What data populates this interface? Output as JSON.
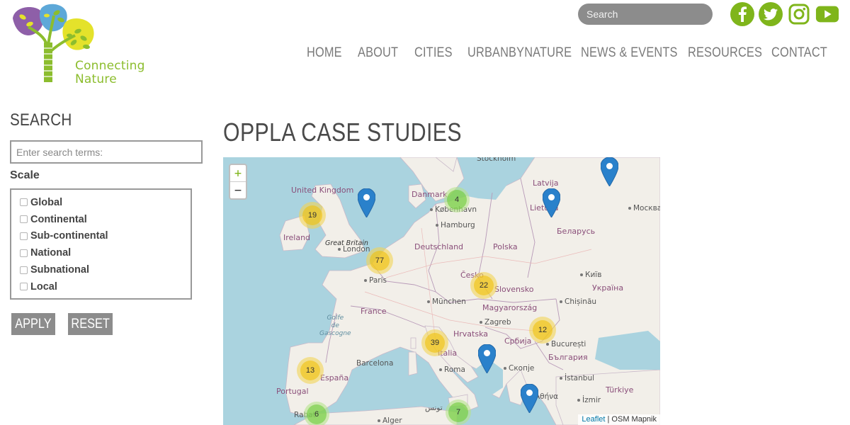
{
  "brand": {
    "logo_text_line1": "Connecting",
    "logo_text_line2": "Nature",
    "accent": "#7fb51b",
    "tree_colors": [
      "#8e5fa8",
      "#5da8d8",
      "#e4e22b",
      "#8cbd2e"
    ]
  },
  "header": {
    "search_placeholder": "Search",
    "social": [
      {
        "icon": "facebook-icon",
        "glyph": "f"
      },
      {
        "icon": "twitter-icon"
      },
      {
        "icon": "instagram-icon"
      },
      {
        "icon": "youtube-icon"
      }
    ]
  },
  "nav": {
    "items": [
      "HOME",
      "ABOUT",
      "CITIES",
      "URBANBYNATURE",
      "NEWS & EVENTS",
      "RESOURCES",
      "CONTACT"
    ]
  },
  "sidebar": {
    "title": "SEARCH",
    "search_placeholder": "Enter search terms:",
    "scale_label": "Scale",
    "scale_options": [
      "Global",
      "Continental",
      "Sub-continental",
      "National",
      "Subnational",
      "Local"
    ],
    "apply_label": "APPLY",
    "reset_label": "RESET"
  },
  "main": {
    "title": "OPPLA CASE STUDIES"
  },
  "map": {
    "zoom_in": "+",
    "zoom_out": "−",
    "attribution_leaflet": "Leaflet",
    "attribution_sep": " | ",
    "attribution_tiles": "OSM Mapnik",
    "clusters": [
      {
        "count": "19",
        "color": "yellow"
      },
      {
        "count": "4",
        "color": "green"
      },
      {
        "count": "77",
        "color": "yellow"
      },
      {
        "count": "22",
        "color": "yellow"
      },
      {
        "count": "12",
        "color": "yellow"
      },
      {
        "count": "39",
        "color": "yellow"
      },
      {
        "count": "13",
        "color": "yellow"
      },
      {
        "count": "6",
        "color": "green"
      },
      {
        "count": "7",
        "color": "green"
      }
    ],
    "labels": {
      "stockholm": "Stockholm",
      "latvija": "Latvija",
      "united_kingdom": "United Kingdom",
      "danmark": "Danmark",
      "kobenhavn": "København",
      "lietuva": "Lietuva",
      "moskva": "Москва",
      "ireland": "Ireland",
      "hamburg": "Hamburg",
      "belarus": "Беларусь",
      "great_britain": "Great Britain",
      "london": "London",
      "deutschland": "Deutschland",
      "polska": "Polska",
      "cesko": "Česko",
      "kyiv": "Київ",
      "paris": "Paris",
      "slovensko": "Slovensko",
      "ukraina": "Україна",
      "munchen": "München",
      "chisinau": "Chișinău",
      "france": "France",
      "magyarorszag": "Magyarország",
      "golfe": "Golfe\nde\nGascogne",
      "zagreb": "Zagreb",
      "hrvatska": "Hrvatska",
      "srbija": "Србија",
      "bucuresti": "București",
      "italia": "Italia",
      "balgariya": "България",
      "barcelona": "Barcelona",
      "roma": "Roma",
      "skopje": "Скопје",
      "espana": "España",
      "istanbul": "İstanbul",
      "portugal": "Portugal",
      "turkiye": "Türkiye",
      "izmir": "İzmir",
      "tunis": "تونس",
      "alger": "Alger",
      "athina": "Αθήνα",
      "rabat": "Rabat"
    }
  }
}
